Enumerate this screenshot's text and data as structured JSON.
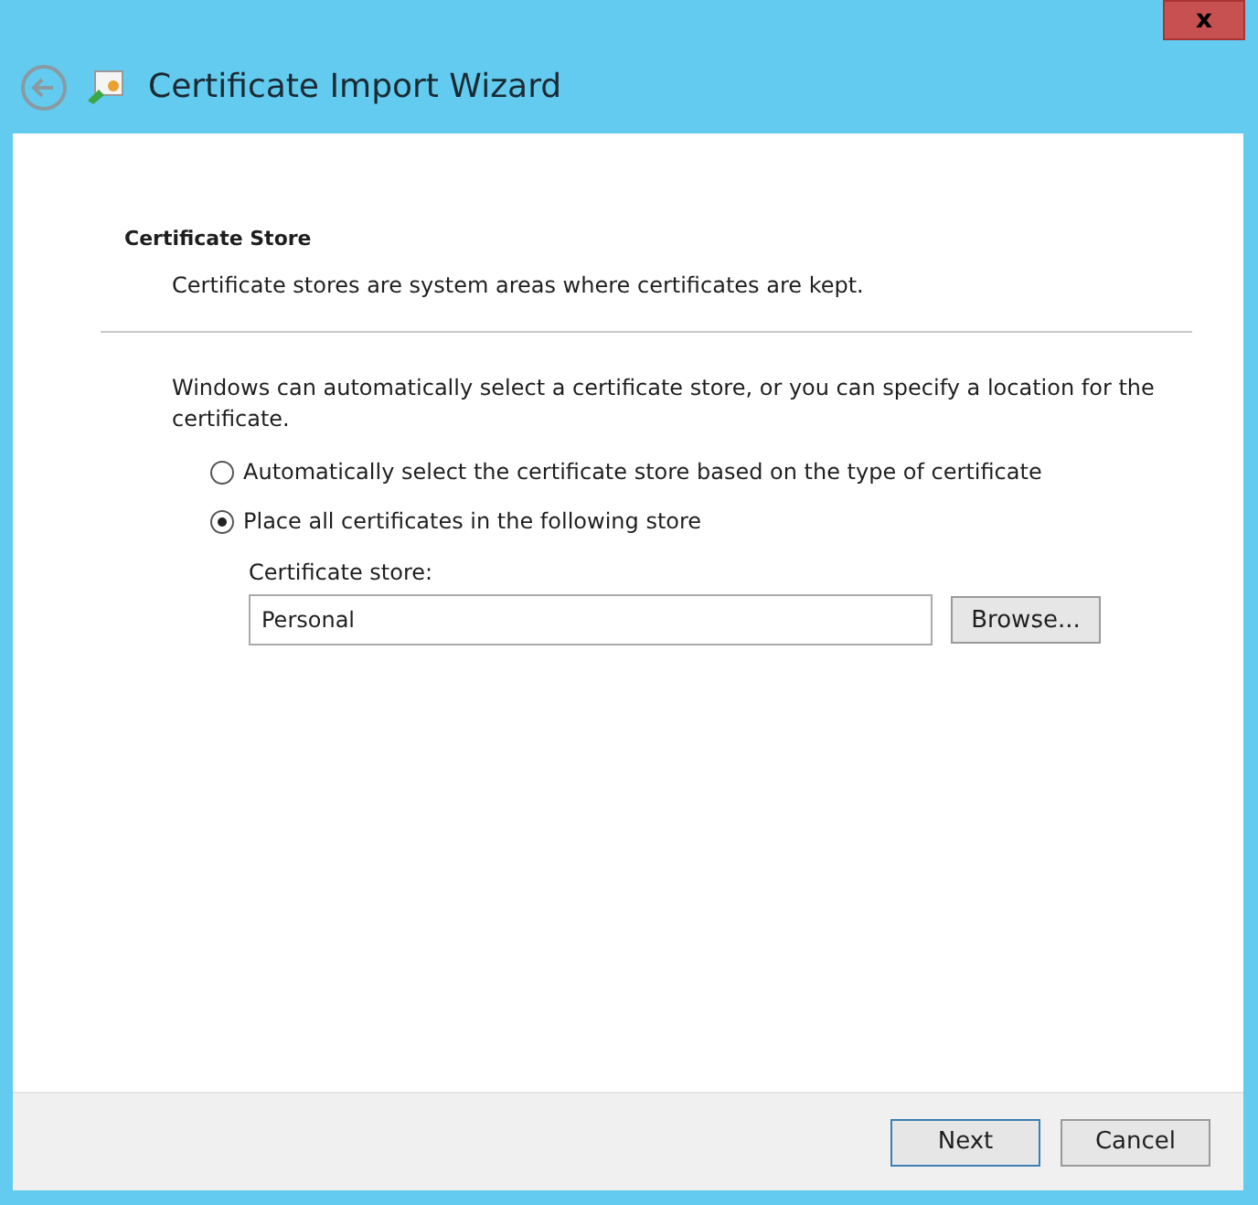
{
  "window": {
    "title": "Certificate Import Wizard",
    "close": "x"
  },
  "section": {
    "heading": "Certificate Store",
    "description": "Certificate stores are system areas where certificates are kept."
  },
  "intro": "Windows can automatically select a certificate store, or you can specify a location for the certificate.",
  "options": [
    {
      "label": "Automatically select the certificate store based on the type of certificate",
      "selected": false
    },
    {
      "label": "Place all certificates in the following store",
      "selected": true
    }
  ],
  "store": {
    "label": "Certificate store:",
    "value": "Personal",
    "browse": "Browse..."
  },
  "buttons": [
    {
      "label": "Next",
      "default": true
    },
    {
      "label": "Cancel",
      "default": false
    }
  ]
}
